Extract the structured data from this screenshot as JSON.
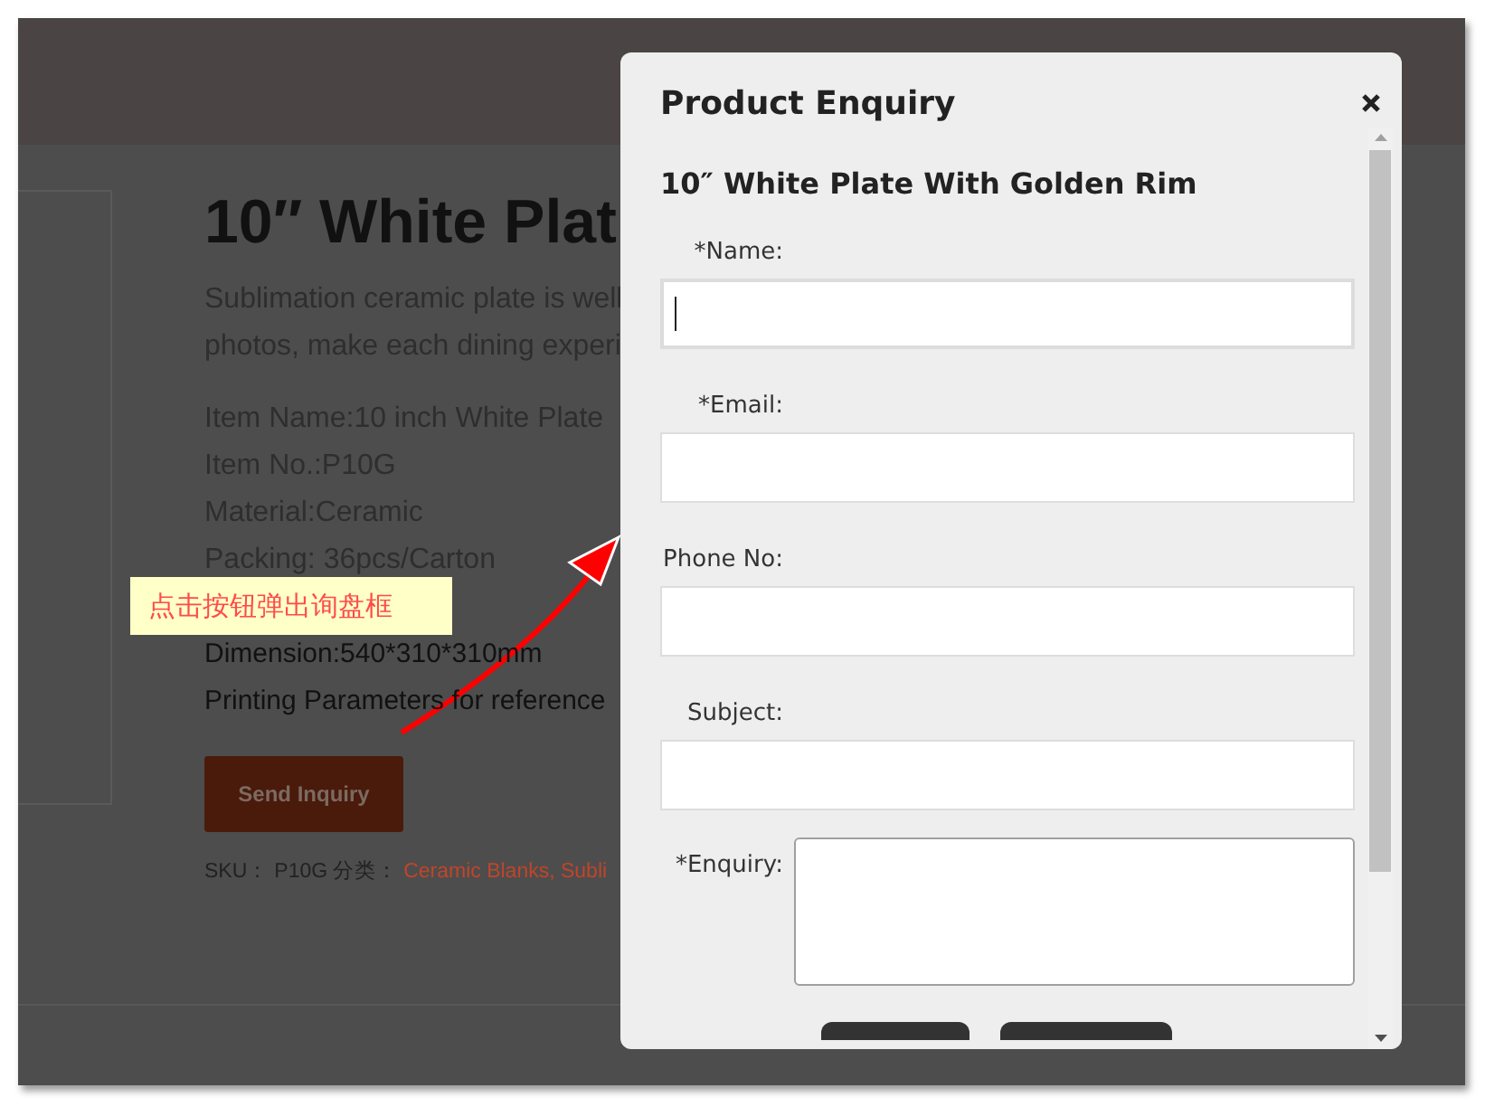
{
  "page": {
    "title": "10″ White Plat",
    "description_lines": [
      "Sublimation ceramic plate is well",
      "photos, make each dining experi"
    ],
    "specs": [
      "Item Name:10 inch White Plate",
      "Item No.:P10G",
      "Material:Ceramic",
      "Packing: 36pcs/Carton"
    ],
    "specs_lower": [
      "Dimension:540*310*310mm",
      "Printing Parameters for reference"
    ],
    "send_button": "Send Inquiry",
    "sku_label": "SKU：",
    "sku": "P10G",
    "category_label": "分类：",
    "categories": "Ceramic Blanks, Subli"
  },
  "annotation": {
    "text": "点击按钮弹出询盘框"
  },
  "modal": {
    "title": "Product Enquiry",
    "product": "10″ White Plate With Golden Rim",
    "fields": [
      {
        "label": "*Name:",
        "kind": "input",
        "focused": true
      },
      {
        "label": "*Email:",
        "kind": "input",
        "focused": false
      },
      {
        "label": "Phone No:",
        "kind": "input",
        "focused": false
      },
      {
        "label": "Subject:",
        "kind": "input",
        "focused": false
      },
      {
        "label": "*Enquiry:",
        "kind": "textarea",
        "focused": false
      }
    ]
  }
}
